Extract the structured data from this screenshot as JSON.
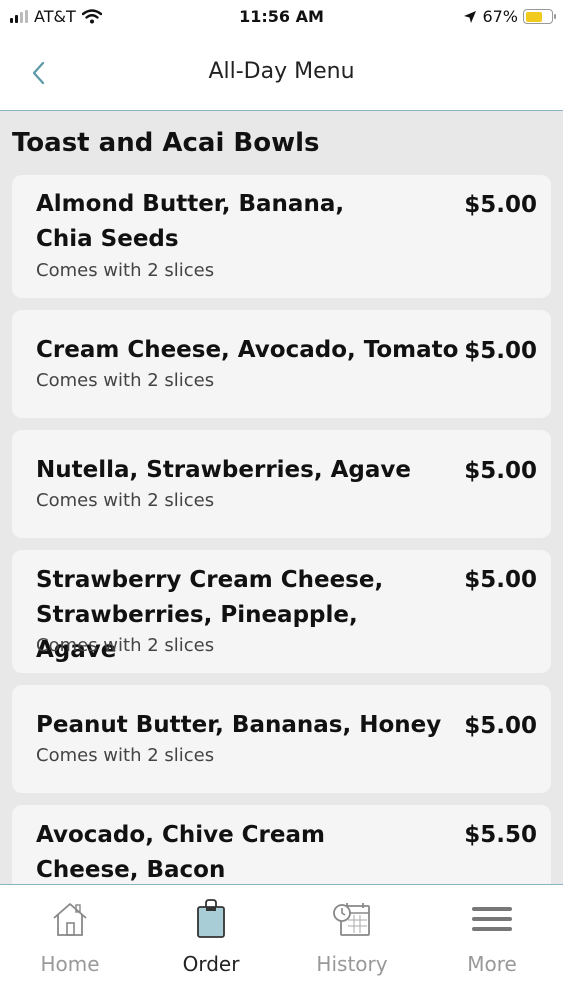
{
  "status_bar": {
    "carrier": "AT&T",
    "time": "11:56 AM",
    "battery_percent": "67%",
    "battery_level": 0.67,
    "icons": [
      "signal-icon",
      "wifi-icon",
      "location-arrow-icon",
      "battery-icon"
    ]
  },
  "nav": {
    "title": "All-Day Menu",
    "back_icon": "chevron-left-icon"
  },
  "section": {
    "title": "Toast and Acai Bowls"
  },
  "items": [
    {
      "name": "Almond Butter, Banana,\nChia Seeds",
      "price": "$5.00",
      "desc": "Comes with 2 slices"
    },
    {
      "name": "Cream Cheese, Avocado, Tomato",
      "price": "$5.00",
      "desc": "Comes with 2 slices"
    },
    {
      "name": "Nutella, Strawberries, Agave",
      "price": "$5.00",
      "desc": "Comes with 2 slices"
    },
    {
      "name": "Strawberry Cream Cheese,\nStrawberries, Pineapple, Agave",
      "price": "$5.00",
      "desc": "Comes with 2 slices"
    },
    {
      "name": "Peanut Butter, Bananas, Honey",
      "price": "$5.00",
      "desc": "Comes with 2 slices"
    },
    {
      "name": "Avocado, Chive Cream\nCheese, Bacon",
      "price": "$5.50",
      "desc": ""
    }
  ],
  "tabs": [
    {
      "label": "Home",
      "icon": "home-icon",
      "active": false
    },
    {
      "label": "Order",
      "icon": "shopping-bag-icon",
      "active": true
    },
    {
      "label": "History",
      "icon": "calendar-clock-icon",
      "active": false
    },
    {
      "label": "More",
      "icon": "menu-icon",
      "active": false
    }
  ],
  "colors": {
    "accent": "#8ab4c2",
    "order_icon_fill": "#a9cdd6",
    "battery": "#f2c91d",
    "background": "#e8e8e8",
    "card": "#f5f5f5"
  }
}
